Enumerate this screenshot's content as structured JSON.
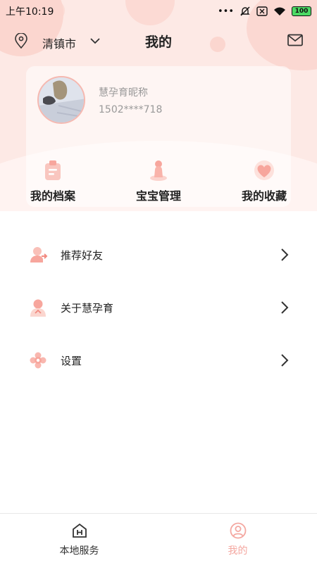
{
  "status_bar": {
    "time": "上午10:19",
    "battery": "100"
  },
  "header": {
    "city": "清镇市",
    "title": "我的"
  },
  "profile": {
    "nickname": "慧孕育昵称",
    "phone": "1502****718"
  },
  "quick_actions": [
    {
      "label": "我的档案",
      "icon": "file-icon"
    },
    {
      "label": "宝宝管理",
      "icon": "baby-icon"
    },
    {
      "label": "我的收藏",
      "icon": "heart-icon"
    }
  ],
  "menu": [
    {
      "label": "推荐好友",
      "icon": "recommend-friend-icon"
    },
    {
      "label": "关于慧孕育",
      "icon": "about-icon"
    },
    {
      "label": "设置",
      "icon": "settings-gear-icon"
    }
  ],
  "tabs": [
    {
      "label": "本地服务",
      "icon": "home-h-icon",
      "active": false
    },
    {
      "label": "我的",
      "icon": "user-icon",
      "active": true
    }
  ],
  "colors": {
    "accent": "#f7a69d",
    "hero_bg": "#fde9e5",
    "blob": "#fbd6cf",
    "tab_active": "#f4a7a0",
    "tab_inactive": "#333333"
  }
}
